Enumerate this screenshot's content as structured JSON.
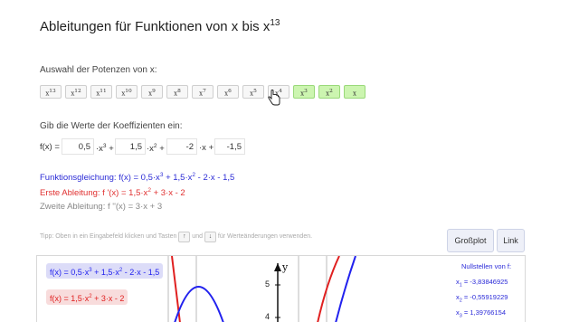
{
  "page_title": "Ableitungen für Funktionen von x bis x",
  "page_title_exp": "13",
  "powers_label": "Auswahl der Potenzen von x:",
  "powers": [
    {
      "label": "x",
      "exp": "13",
      "active": false
    },
    {
      "label": "x",
      "exp": "12",
      "active": false
    },
    {
      "label": "x",
      "exp": "11",
      "active": false
    },
    {
      "label": "x",
      "exp": "10",
      "active": false
    },
    {
      "label": "x",
      "exp": "9",
      "active": false
    },
    {
      "label": "x",
      "exp": "8",
      "active": false
    },
    {
      "label": "x",
      "exp": "7",
      "active": false
    },
    {
      "label": "x",
      "exp": "6",
      "active": false
    },
    {
      "label": "x",
      "exp": "5",
      "active": false
    },
    {
      "label": "x",
      "exp": "4",
      "active": false
    },
    {
      "label": "x",
      "exp": "3",
      "active": true
    },
    {
      "label": "x",
      "exp": "2",
      "active": true
    },
    {
      "label": "x",
      "exp": "",
      "active": true
    }
  ],
  "coef_label": "Gib die Werte der Koeffizienten ein:",
  "fx_prefix": "f(x) =",
  "coefficients": [
    "0,5",
    "1,5",
    "-2",
    "-1,5"
  ],
  "terms": [
    {
      "text": "·x",
      "exp": "3",
      "op": "+"
    },
    {
      "text": "·x",
      "exp": "2",
      "op": "+"
    },
    {
      "text": "·x",
      "exp": "",
      "op": "+"
    }
  ],
  "equations": {
    "funktion_label": "Funktionsgleichung: f(x) = 0,5·x",
    "funktion_rest1": " + 1,5·x",
    "funktion_rest2": " - 2·x - 1,5",
    "erste_label": "Erste Ableitung: f '(x) = 1,5·x",
    "erste_rest": " + 3·x - 2",
    "zweite": "Zweite Ableitung: f ''(x) = 3·x + 3"
  },
  "tip": {
    "part1": "Tipp: Oben in ein Eingabefeld klicken und Tasten",
    "key_up": "↑",
    "und": "und",
    "key_down": "↓",
    "part2": "für Werteänderungen verwenden."
  },
  "buttons": {
    "grossplot": "Großplot",
    "link": "Link"
  },
  "graph": {
    "legend_f_a": "f(x) = 0,5·x",
    "legend_f_b": " + 1,5·x",
    "legend_f_c": " - 2·x - 1,5",
    "legend_d_a": "f(x) = 1,5·x",
    "legend_d_b": " + 3·x - 2",
    "y_axis_label": "y",
    "y_ticks": [
      "5",
      "4"
    ],
    "nullstellen_title": "Nullstellen von f:",
    "roots": [
      {
        "name": "x",
        "sub": "1",
        "value": " = -3,83846925"
      },
      {
        "name": "x",
        "sub": "2",
        "value": " = -0,55919229"
      },
      {
        "name": "x",
        "sub": "3",
        "value": " = 1,39766154"
      }
    ],
    "colors": {
      "f": "#2222ee",
      "f_prime": "#ee2222",
      "f_second": "#999999"
    }
  }
}
